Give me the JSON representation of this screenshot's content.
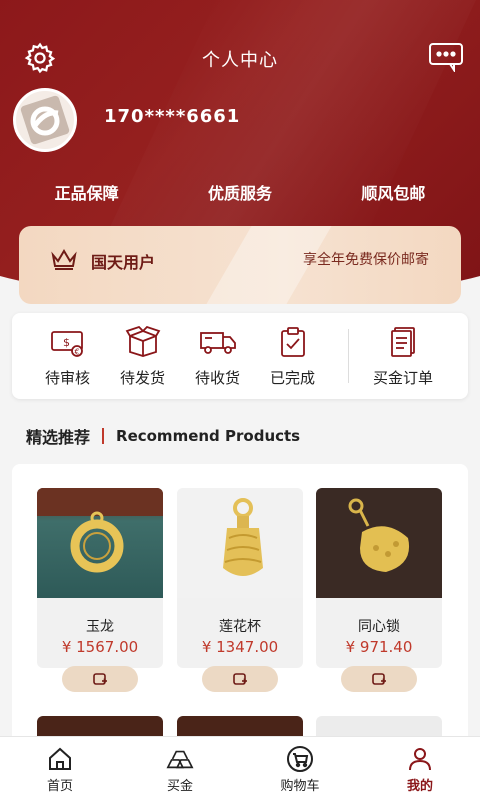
{
  "header": {
    "title": "个人中心",
    "settings_icon": "gear-icon",
    "message_icon": "chat-bubble-icon",
    "phone": "170****6661"
  },
  "perks": [
    "正品保障",
    "优质服务",
    "顺风包邮"
  ],
  "vip": {
    "level": "国天用户",
    "benefit": "享全年免费保价邮寄",
    "icon": "crown-icon"
  },
  "orders": {
    "items": [
      {
        "label": "待审核",
        "icon": "money-review-icon"
      },
      {
        "label": "待发货",
        "icon": "box-icon"
      },
      {
        "label": "待收货",
        "icon": "truck-icon"
      },
      {
        "label": "已完成",
        "icon": "clipboard-check-icon"
      }
    ],
    "gold_order": {
      "label": "买金订单",
      "icon": "document-icon"
    }
  },
  "recommend": {
    "title_cn": "精选推荐",
    "title_en": "Recommend Products"
  },
  "products": [
    {
      "name": "玉龙",
      "price": "¥ 1567.00"
    },
    {
      "name": "莲花杯",
      "price": "¥ 1347.00"
    },
    {
      "name": "同心锁",
      "price": "¥ 971.40"
    }
  ],
  "nav": [
    {
      "label": "首页",
      "icon": "home-icon"
    },
    {
      "label": "买金",
      "icon": "gold-bars-icon"
    },
    {
      "label": "购物车",
      "icon": "cart-icon"
    },
    {
      "label": "我的",
      "icon": "user-icon",
      "active": true
    }
  ],
  "colors": {
    "brand": "#8a1619",
    "price": "#c0392b",
    "vip_bg": "#f3d8c1"
  }
}
